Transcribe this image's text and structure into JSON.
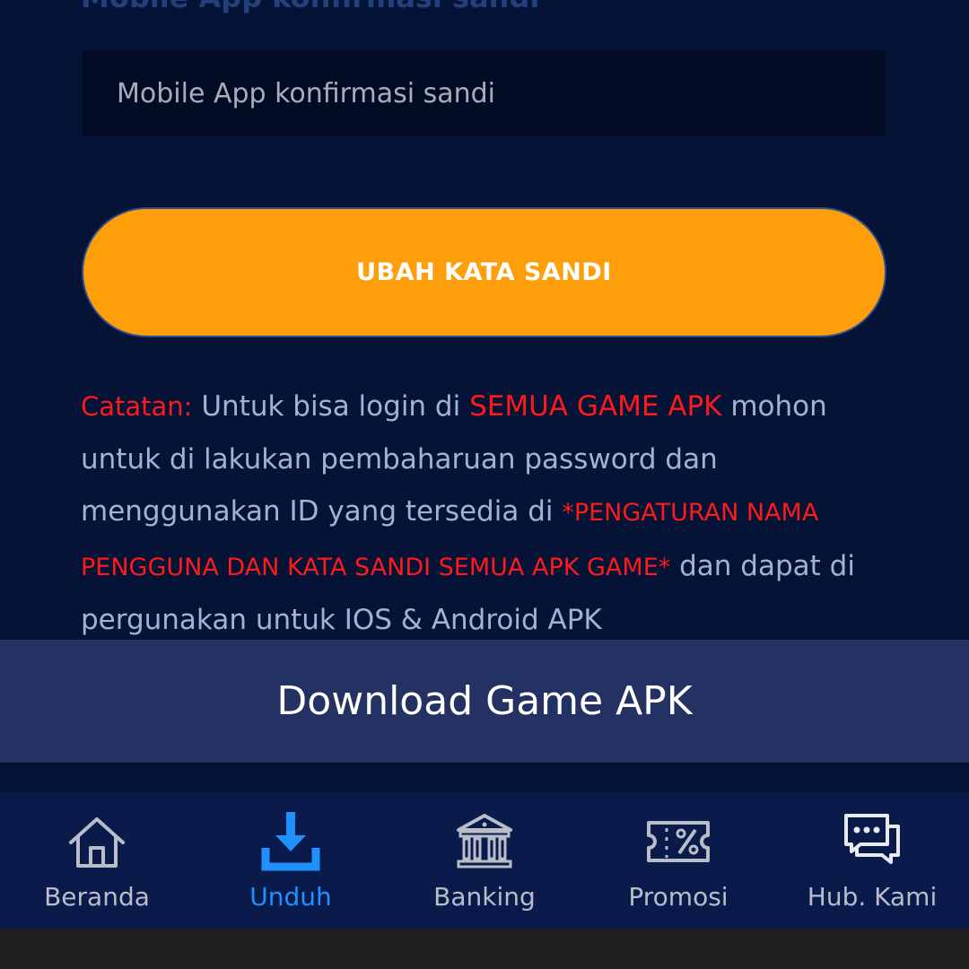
{
  "form": {
    "field_label": "Mobile App konfirmasi sandi",
    "confirm_password_placeholder": "Mobile App konfirmasi sandi",
    "submit_label": "UBAH KATA SANDI"
  },
  "note": {
    "label": "Catatan:",
    "text_1": " Untuk bisa login di ",
    "highlight_1": "SEMUA GAME APK",
    "text_2": " mohon untuk di lakukan pembaharuan password dan menggunakan ID yang tersedia di ",
    "highlight_2": "*PENGATURAN NAMA PENGGUNA DAN KATA SANDI SEMUA APK GAME*",
    "text_3": " dan dapat di pergunakan untuk IOS & Android APK"
  },
  "download_bar": {
    "label": "Download Game APK"
  },
  "bottom_nav": {
    "items": [
      {
        "label": "Beranda",
        "icon": "home-icon",
        "active": false
      },
      {
        "label": "Unduh",
        "icon": "download-icon",
        "active": true
      },
      {
        "label": "Banking",
        "icon": "bank-icon",
        "active": false
      },
      {
        "label": "Promosi",
        "icon": "coupon-percent-icon",
        "active": false
      },
      {
        "label": "Hub. Kami",
        "icon": "chat-icon",
        "active": false
      }
    ]
  },
  "colors": {
    "background": "#041336",
    "accent_orange": "#ff9e0b",
    "highlight_red": "#ff1a1a",
    "active_blue": "#1e90ff",
    "download_bar": "#233262",
    "nav_background": "#0a1a4b"
  }
}
